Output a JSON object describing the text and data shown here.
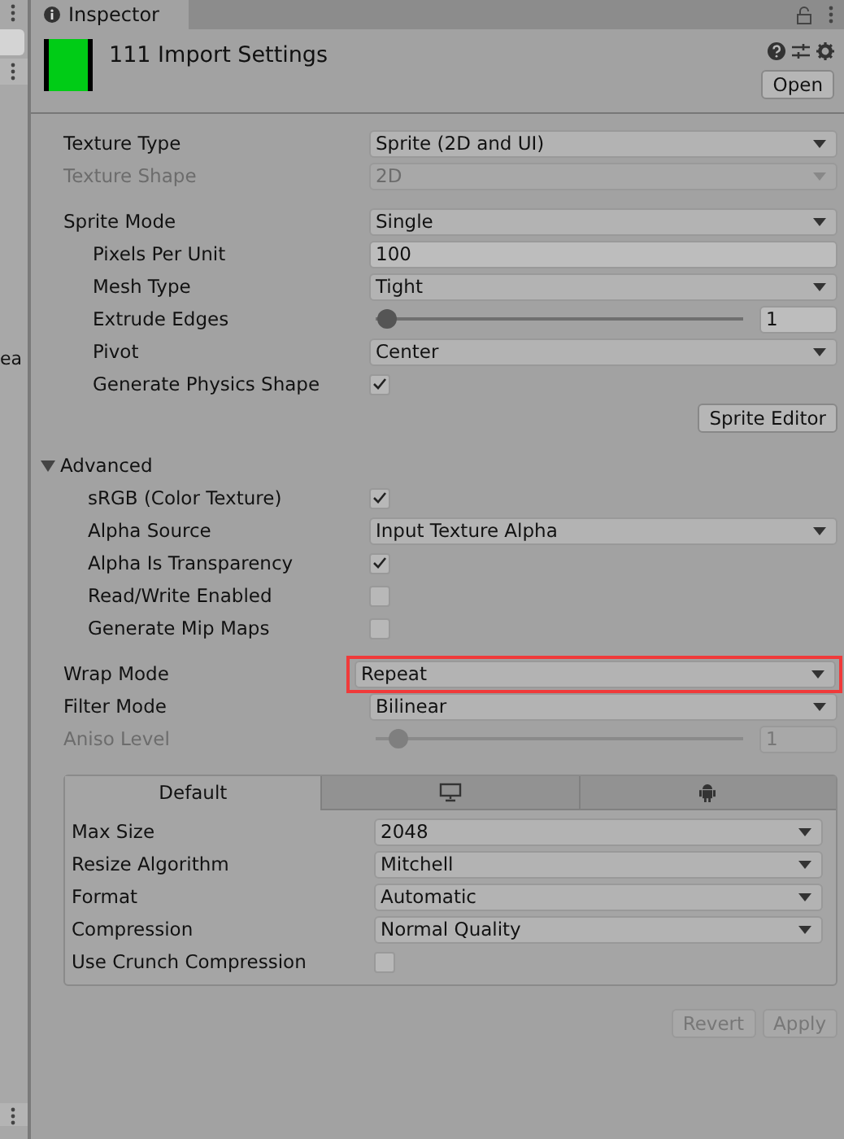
{
  "left_panel": {
    "text": "ea"
  },
  "tab": {
    "label": "Inspector"
  },
  "header": {
    "title": "111 Import Settings",
    "color": "#00cc16",
    "open_button": "Open"
  },
  "sections": [
    [
      {
        "kind": "dropdown",
        "label": "Texture Type",
        "value": "Sprite (2D and UI)",
        "disabled": false,
        "highlighted": false
      },
      {
        "kind": "dropdown",
        "label": "Texture Shape",
        "value": "2D",
        "disabled": true,
        "highlighted": false
      }
    ],
    [
      {
        "kind": "dropdown",
        "label": "Sprite Mode",
        "value": "Single",
        "disabled": false,
        "highlighted": false,
        "children": [
          {
            "kind": "field",
            "label": "Pixels Per Unit",
            "value": "100",
            "disabled": false
          },
          {
            "kind": "dropdown",
            "label": "Mesh Type",
            "value": "Tight",
            "disabled": false,
            "highlighted": false
          },
          {
            "kind": "slider",
            "label": "Extrude Edges",
            "value": "1",
            "level": 0.03,
            "disabled": false
          },
          {
            "kind": "dropdown",
            "label": "Pivot",
            "value": "Center",
            "disabled": false,
            "highlighted": false
          },
          {
            "kind": "checkbox",
            "label": "Generate Physics Shape",
            "checked": true,
            "disabled": false
          }
        ]
      },
      {
        "kind": "button",
        "label": "Sprite Editor"
      }
    ],
    [
      {
        "kind": "foldout",
        "label": "Advanced",
        "expanded": true,
        "children": [
          {
            "kind": "checkbox",
            "label": "sRGB (Color Texture)",
            "checked": true,
            "disabled": false
          },
          {
            "kind": "dropdown",
            "label": "Alpha Source",
            "value": "Input Texture Alpha",
            "disabled": false,
            "highlighted": false
          },
          {
            "kind": "checkbox",
            "label": "Alpha Is Transparency",
            "checked": true,
            "disabled": false
          },
          {
            "kind": "checkbox",
            "label": "Read/Write Enabled",
            "checked": false,
            "disabled": false
          },
          {
            "kind": "checkbox",
            "label": "Generate Mip Maps",
            "checked": false,
            "disabled": false
          }
        ]
      }
    ],
    [
      {
        "kind": "dropdown",
        "label": "Wrap Mode",
        "value": "Repeat",
        "disabled": false,
        "highlighted": true
      },
      {
        "kind": "dropdown",
        "label": "Filter Mode",
        "value": "Bilinear",
        "disabled": false,
        "highlighted": false
      },
      {
        "kind": "slider",
        "label": "Aniso Level",
        "value": "1",
        "level": 0.06,
        "disabled": true
      }
    ]
  ],
  "platforms": {
    "tabs": [
      {
        "kind": "text",
        "label": "Default",
        "selected": true
      },
      {
        "kind": "monitor",
        "selected": false
      },
      {
        "kind": "robot",
        "selected": false
      }
    ],
    "rows": [
      {
        "kind": "dropdown",
        "label": "Max Size",
        "value": "2048",
        "disabled": false,
        "highlighted": false
      },
      {
        "kind": "dropdown",
        "label": "Resize Algorithm",
        "value": "Mitchell",
        "disabled": false,
        "highlighted": false
      },
      {
        "kind": "dropdown",
        "label": "Format",
        "value": "Automatic",
        "disabled": false,
        "highlighted": false
      },
      {
        "kind": "dropdown",
        "label": "Compression",
        "value": "Normal Quality",
        "disabled": false,
        "highlighted": false
      },
      {
        "kind": "checkbox",
        "label": "Use Crunch Compression",
        "checked": false,
        "disabled": false
      }
    ]
  },
  "footer_buttons": [
    {
      "label": "Revert",
      "disabled": true
    },
    {
      "label": "Apply",
      "disabled": true
    }
  ]
}
